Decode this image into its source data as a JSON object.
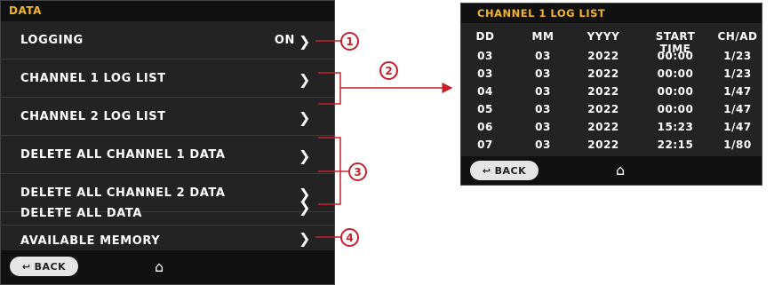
{
  "left": {
    "title": "DATA",
    "items": [
      {
        "label": "LOGGING",
        "value": "ON"
      },
      {
        "label": "CHANNEL 1 LOG LIST",
        "value": ""
      },
      {
        "label": "CHANNEL 2 LOG LIST",
        "value": ""
      },
      {
        "label": "DELETE ALL CHANNEL 1 DATA",
        "value": ""
      },
      {
        "label": "DELETE ALL CHANNEL 2 DATA",
        "value": ""
      },
      {
        "label": "DELETE ALL DATA",
        "value": ""
      },
      {
        "label": "AVAILABLE MEMORY",
        "value": ""
      }
    ],
    "back_label": "BACK"
  },
  "right": {
    "title": "CHANNEL 1 LOG LIST",
    "columns": [
      "DD",
      "MM",
      "YYYY",
      "START TIME",
      "CH/AD"
    ],
    "rows": [
      [
        "03",
        "03",
        "2022",
        "00:00",
        "1/23"
      ],
      [
        "03",
        "03",
        "2022",
        "00:00",
        "1/23"
      ],
      [
        "04",
        "03",
        "2022",
        "00:00",
        "1/47"
      ],
      [
        "05",
        "03",
        "2022",
        "00:00",
        "1/47"
      ],
      [
        "06",
        "03",
        "2022",
        "15:23",
        "1/47"
      ],
      [
        "07",
        "03",
        "2022",
        "22:15",
        "1/80"
      ]
    ],
    "back_label": "BACK"
  },
  "callouts": [
    "1",
    "2",
    "3",
    "4"
  ],
  "colors": {
    "accent": "#f3b527",
    "annotation": "#c8202a",
    "screen_bg": "#232323"
  }
}
